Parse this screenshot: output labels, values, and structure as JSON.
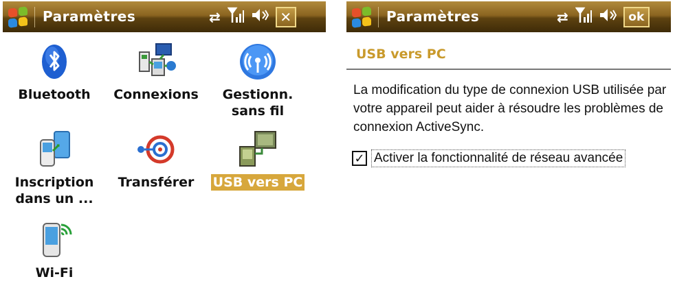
{
  "left": {
    "title": "Paramètres",
    "close_glyph": "✕",
    "status_icons": [
      "sync-arrows-icon",
      "signal-bars-icon",
      "volume-icon"
    ],
    "tiles": [
      {
        "label": "Bluetooth",
        "icon": "bluetooth-icon"
      },
      {
        "label": "Connexions",
        "icon": "connections-icon"
      },
      {
        "label": "Gestionn.\nsans fil",
        "icon": "wireless-manager-icon"
      },
      {
        "label": "Inscription\ndans un ...",
        "icon": "domain-enroll-icon"
      },
      {
        "label": "Transférer",
        "icon": "beam-icon"
      },
      {
        "label": "USB vers PC",
        "icon": "usb-to-pc-icon",
        "selected": true
      },
      {
        "label": "Wi-Fi",
        "icon": "wifi-icon"
      }
    ]
  },
  "right": {
    "title": "Paramètres",
    "ok_label": "ok",
    "heading": "USB vers PC",
    "description": "La modification du type de connexion USB utilisée par votre appareil peut aider à résoudre les problèmes de connexion ActiveSync.",
    "checkbox": {
      "label": "Activer la fonctionnalité de réseau avancée",
      "checked": true,
      "glyph": "✓"
    }
  },
  "colors": {
    "titlebar": "#8a6420",
    "selection": "#d7a73c",
    "heading": "#c99a2c"
  }
}
